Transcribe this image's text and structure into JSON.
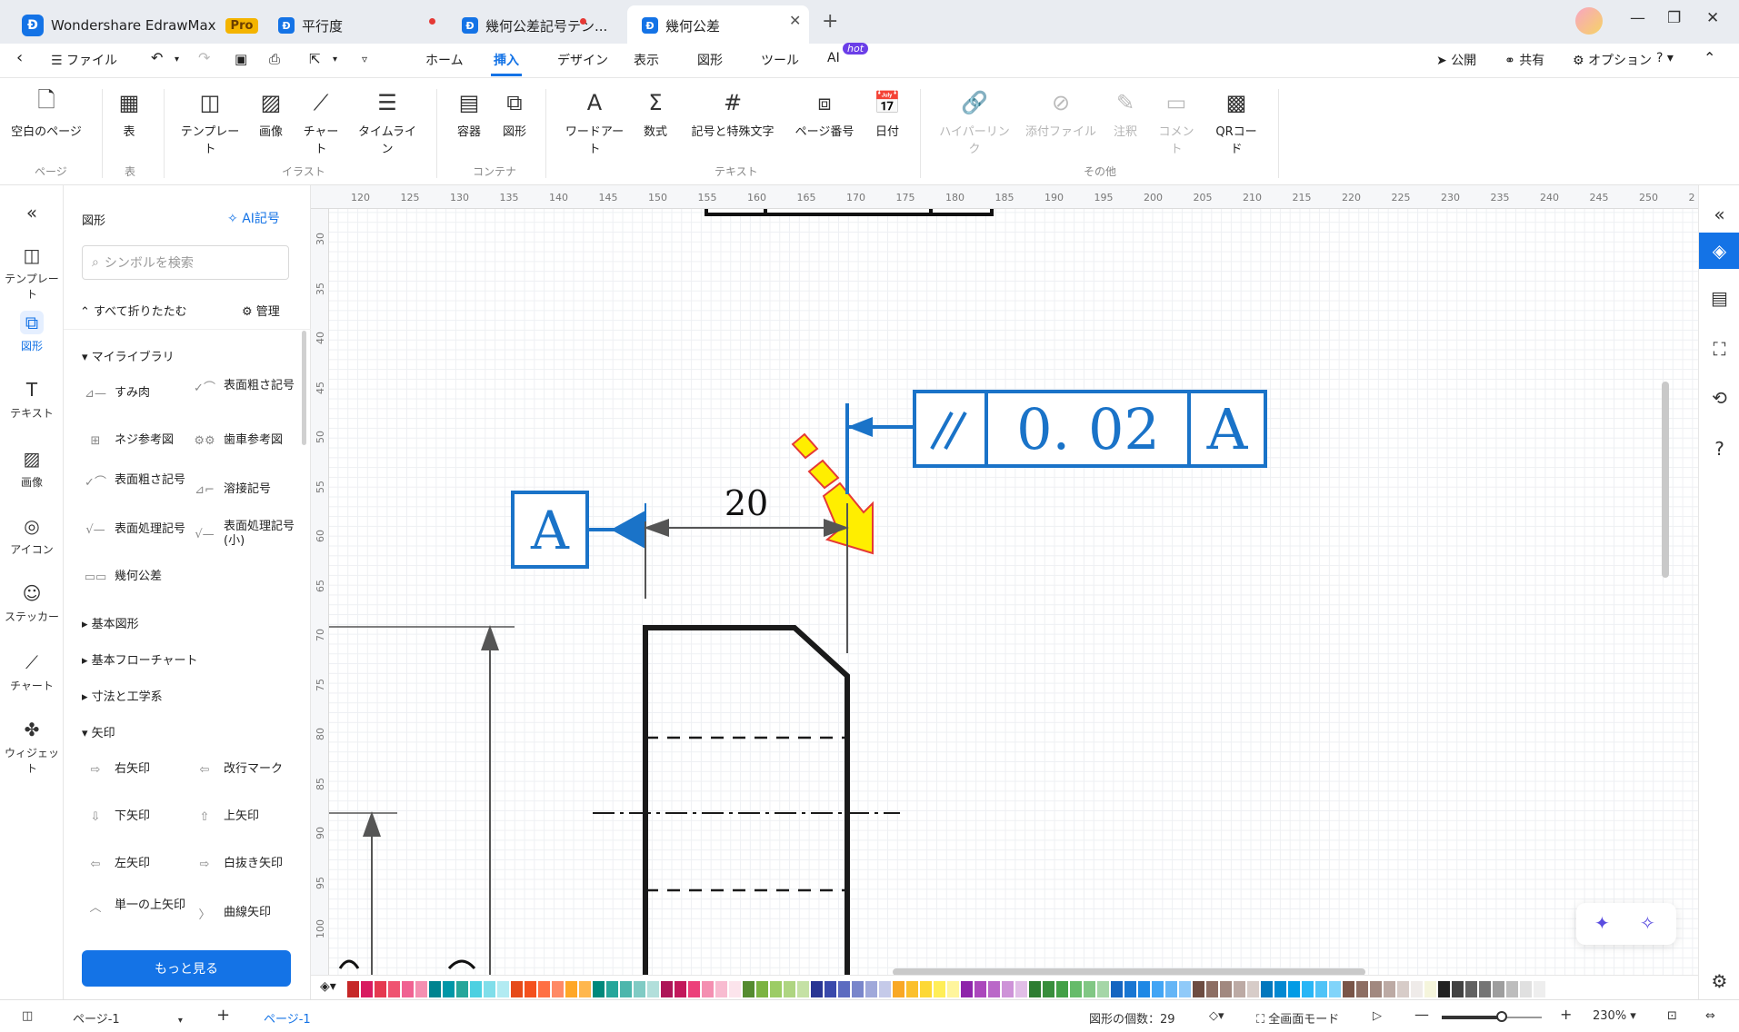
{
  "titlebar": {
    "app_name": "Wondershare EdrawMax",
    "pro_badge": "Pro",
    "tabs": [
      "平行度",
      "幾何公差記号テン...",
      "幾何公差"
    ]
  },
  "menubar": {
    "file": "ファイル",
    "tabs": [
      "ホーム",
      "挿入",
      "デザイン",
      "表示",
      "図形",
      "ツール",
      "AI"
    ],
    "hot_badge": "hot",
    "publish": "公開",
    "share": "共有",
    "options": "オプション"
  },
  "ribbon": {
    "buttons": [
      "空白のページ",
      "表",
      "テンプレート",
      "画像",
      "チャート",
      "タイムライン",
      "容器",
      "図形",
      "ワードアート",
      "数式",
      "記号と特殊文字",
      "ページ番号",
      "日付",
      "ハイパーリンク",
      "添付ファイル",
      "注釈",
      "コメント",
      "QRコード"
    ],
    "groups": [
      "ページ",
      "表",
      "イラスト",
      "コンテナ",
      "テキスト",
      "その他"
    ]
  },
  "leftrail": [
    "テンプレート",
    "図形",
    "テキスト",
    "画像",
    "アイコン",
    "ステッカー",
    "チャート",
    "ウィジェット"
  ],
  "panel": {
    "title": "図形",
    "ai_symbol": "AI記号",
    "search_placeholder": "シンボルを検索",
    "collapse_all": "すべて折りたたむ",
    "manage": "管理",
    "sections": [
      "マイライブラリ",
      "基本図形",
      "基本フローチャート",
      "寸法と工学系",
      "矢印"
    ],
    "my_library": [
      "すみ肉",
      "表面粗さ記号",
      "ネジ参考図",
      "歯車参考図",
      "表面粗さ記号",
      "溶接記号",
      "表面処理記号",
      "表面処理記号(小)",
      "幾何公差"
    ],
    "arrows": [
      "右矢印",
      "改行マーク",
      "下矢印",
      "上矢印",
      "左矢印",
      "白抜き矢印",
      "単一の上矢印",
      "曲線矢印"
    ],
    "more_button": "もっと見る"
  },
  "ruler": {
    "h": [
      "120",
      "125",
      "130",
      "135",
      "140",
      "145",
      "150",
      "155",
      "160",
      "165",
      "170",
      "175",
      "180",
      "185",
      "190",
      "195",
      "200",
      "205",
      "210",
      "215",
      "220",
      "225",
      "230",
      "235",
      "240",
      "245",
      "250",
      "2"
    ],
    "v": [
      "30",
      "35",
      "40",
      "45",
      "50",
      "55",
      "60",
      "65",
      "70",
      "75",
      "80",
      "85",
      "90",
      "95",
      "100"
    ]
  },
  "drawing": {
    "top_frame_value": "0. 02",
    "top_frame_datum": "A",
    "frame_symbol": "//",
    "frame_value": "0. 02",
    "frame_datum": "A",
    "datum_label": "A",
    "dimension": "20"
  },
  "statusbar": {
    "page_select": "ページ-1",
    "page_tab": "ページ-1",
    "shape_count": "図形の個数：29",
    "fullscreen": "全画面モード",
    "zoom": "230%"
  },
  "colors": {
    "accent": "#1473e6",
    "gdt_blue": "#1a73c8",
    "arrow_yellow": "#ffee00",
    "arrow_red": "#e53935"
  },
  "palette": [
    "#c62828",
    "#d81b60",
    "#e53950",
    "#ef5370",
    "#f06292",
    "#f48fb1",
    "#00838f",
    "#0097a7",
    "#26a69a",
    "#4dd0e1",
    "#80deea",
    "#b2ebf2",
    "#e64a19",
    "#f4511e",
    "#ff7043",
    "#ff8a65",
    "#ffa726",
    "#ffb74d",
    "#00897b",
    "#26a69a",
    "#4db6ac",
    "#80cbc4",
    "#b2dfdb",
    "#ad1457",
    "#c2185b",
    "#ec407a",
    "#f48fb1",
    "#f8bbd0",
    "#fce4ec",
    "#558b2f",
    "#7cb342",
    "#9ccc65",
    "#aed581",
    "#c5e1a5",
    "#283593",
    "#3949ab",
    "#5c6bc0",
    "#7986cb",
    "#9fa8da",
    "#c5cae9",
    "#f9a825",
    "#fbc02d",
    "#fdd835",
    "#ffee58",
    "#fff59d",
    "#8e24aa",
    "#ab47bc",
    "#ba68c8",
    "#ce93d8",
    "#e1bee7",
    "#2e7d32",
    "#388e3c",
    "#43a047",
    "#66bb6a",
    "#81c784",
    "#a5d6a7",
    "#1565c0",
    "#1976d2",
    "#1e88e5",
    "#42a5f5",
    "#64b5f6",
    "#90caf9",
    "#6d4c41",
    "#8d6e63",
    "#a1887f",
    "#bcaaa4",
    "#d7ccc8",
    "#0277bd",
    "#0288d1",
    "#039be5",
    "#29b6f6",
    "#4fc3f7",
    "#81d4fa",
    "#795548",
    "#8d6e63",
    "#a1887f",
    "#bcaaa4",
    "#d7ccc8",
    "#efebe9",
    "#f5f5dc",
    "#212121",
    "#424242",
    "#616161",
    "#757575",
    "#9e9e9e",
    "#bdbdbd",
    "#e0e0e0",
    "#eeeeee"
  ]
}
